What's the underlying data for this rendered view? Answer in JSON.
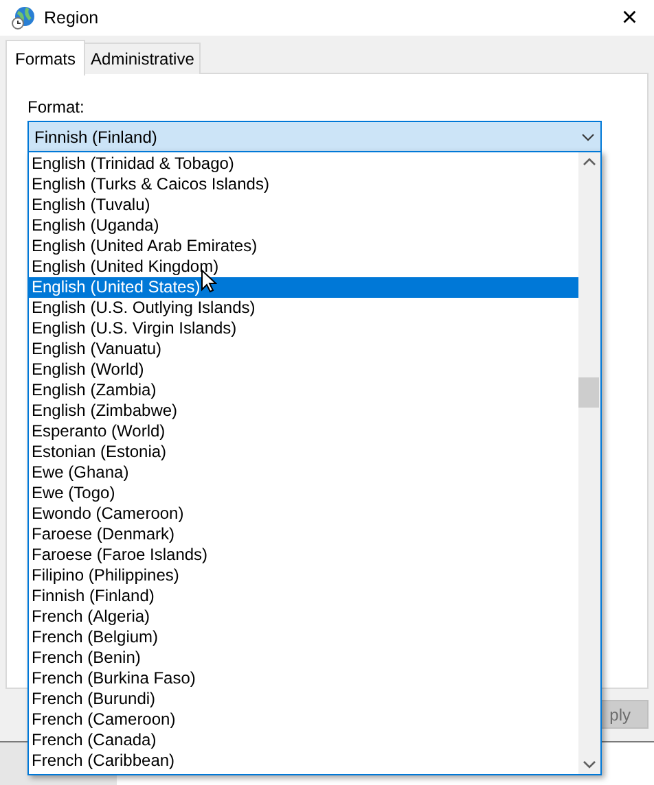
{
  "window": {
    "title": "Region",
    "close": "×"
  },
  "tabs": [
    {
      "label": "Formats",
      "selected": true
    },
    {
      "label": "Administrative",
      "selected": false
    }
  ],
  "format": {
    "label": "Format:",
    "value": "Finnish (Finland)",
    "expanded": true,
    "options": [
      {
        "label": "English (Trinidad & Tobago)",
        "highlighted": false
      },
      {
        "label": "English (Turks & Caicos Islands)",
        "highlighted": false
      },
      {
        "label": "English (Tuvalu)",
        "highlighted": false
      },
      {
        "label": "English (Uganda)",
        "highlighted": false
      },
      {
        "label": "English (United Arab Emirates)",
        "highlighted": false
      },
      {
        "label": "English (United Kingdom)",
        "highlighted": false
      },
      {
        "label": "English (United States)",
        "highlighted": true
      },
      {
        "label": "English (U.S. Outlying Islands)",
        "highlighted": false
      },
      {
        "label": "English (U.S. Virgin Islands)",
        "highlighted": false
      },
      {
        "label": "English (Vanuatu)",
        "highlighted": false
      },
      {
        "label": "English (World)",
        "highlighted": false
      },
      {
        "label": "English (Zambia)",
        "highlighted": false
      },
      {
        "label": "English (Zimbabwe)",
        "highlighted": false
      },
      {
        "label": "Esperanto (World)",
        "highlighted": false
      },
      {
        "label": "Estonian (Estonia)",
        "highlighted": false
      },
      {
        "label": "Ewe (Ghana)",
        "highlighted": false
      },
      {
        "label": "Ewe (Togo)",
        "highlighted": false
      },
      {
        "label": "Ewondo (Cameroon)",
        "highlighted": false
      },
      {
        "label": "Faroese (Denmark)",
        "highlighted": false
      },
      {
        "label": "Faroese (Faroe Islands)",
        "highlighted": false
      },
      {
        "label": "Filipino (Philippines)",
        "highlighted": false
      },
      {
        "label": "Finnish (Finland)",
        "highlighted": false
      },
      {
        "label": "French (Algeria)",
        "highlighted": false
      },
      {
        "label": "French (Belgium)",
        "highlighted": false
      },
      {
        "label": "French (Benin)",
        "highlighted": false
      },
      {
        "label": "French (Burkina Faso)",
        "highlighted": false
      },
      {
        "label": "French (Burundi)",
        "highlighted": false
      },
      {
        "label": "French (Cameroon)",
        "highlighted": false
      },
      {
        "label": "French (Canada)",
        "highlighted": false
      },
      {
        "label": "French (Caribbean)",
        "highlighted": false
      }
    ]
  },
  "buttons": [
    {
      "label": "ply",
      "disabled": true
    }
  ]
}
